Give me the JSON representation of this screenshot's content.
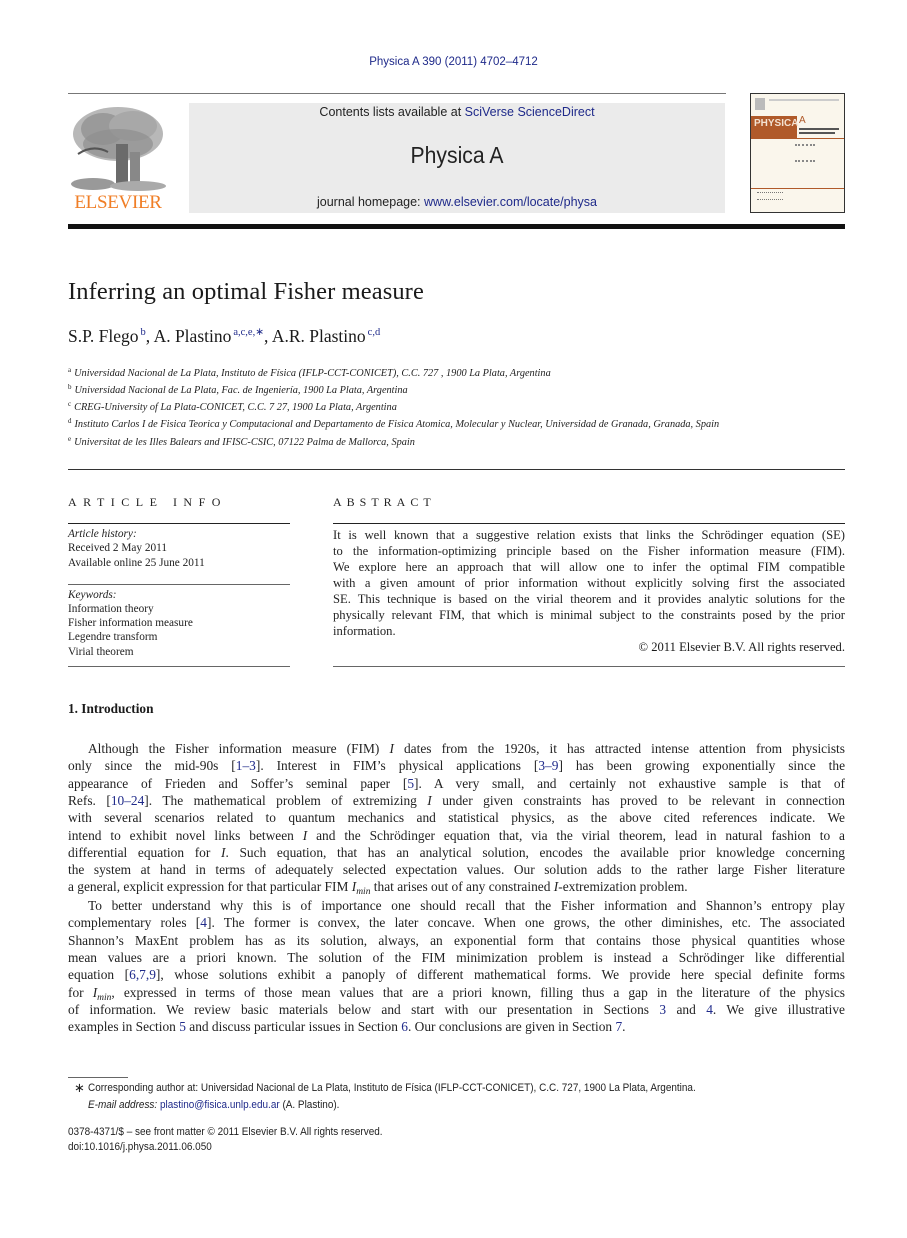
{
  "header": {
    "citation": "Physica A 390 (2011) 4702–4712",
    "contents_prefix": "Contents lists available at ",
    "contents_link": "SciVerse ScienceDirect",
    "journal_name": "Physica A",
    "homepage_prefix": "journal homepage: ",
    "homepage_link": "www.elsevier.com/locate/physa",
    "publisher_logo_text": "ELSEVIER",
    "cover_title": "PHYSICA",
    "cover_letter": "A",
    "colors": {
      "link": "#1f2a8a",
      "elsevier_orange": "#f07e26",
      "banner_bg": "#ebebeb",
      "cover_brown": "#b05a2a"
    }
  },
  "article": {
    "title": "Inferring an optimal Fisher measure",
    "authors": [
      {
        "name": "S.P. Flego",
        "sup": "b",
        "sep": ", "
      },
      {
        "name": "A. Plastino",
        "sup": "a,c,e,∗",
        "sep": ", "
      },
      {
        "name": "A.R. Plastino",
        "sup": "c,d",
        "sep": ""
      }
    ],
    "affiliations": [
      {
        "key": "a",
        "text": "Universidad Nacional de La Plata, Instituto de Física (IFLP-CCT-CONICET), C.C. 727 , 1900 La Plata, Argentina"
      },
      {
        "key": "b",
        "text": "Universidad Nacional de La Plata, Fac. de Ingeniería, 1900 La Plata, Argentina"
      },
      {
        "key": "c",
        "text": "CREG-University of La Plata-CONICET, C.C. 7 27, 1900 La Plata, Argentina"
      },
      {
        "key": "d",
        "text": "Instituto Carlos I de Fisica Teorica y Computacional and Departamento de Fisica Atomica, Molecular y Nuclear, Universidad de Granada, Granada, Spain"
      },
      {
        "key": "e",
        "text": "Universitat de les Illes Balears and IFISC-CSIC, 07122 Palma de Mallorca, Spain"
      }
    ]
  },
  "article_info": {
    "heading": "ARTICLE INFO",
    "history_label": "Article history:",
    "received": "Received 2 May 2011",
    "available": "Available online 25 June 2011",
    "keywords_label": "Keywords:",
    "keywords": [
      "Information theory",
      "Fisher information measure",
      "Legendre transform",
      "Virial theorem"
    ]
  },
  "abstract": {
    "heading": "ABSTRACT",
    "lines": [
      "It is well known that a suggestive relation exists that links the Schrödinger equation (SE)",
      "to the information-optimizing principle based on the Fisher information measure (FIM).",
      "We explore here an approach that will allow one to infer the optimal FIM compatible",
      "with a given amount of prior information without explicitly solving first the associated",
      "SE. This technique is based on the virial theorem and it provides analytic solutions for the",
      "physically relevant FIM, that which is minimal subject to the constraints posed by the prior",
      "information."
    ],
    "copyright": "© 2011 Elsevier B.V. All rights reserved."
  },
  "introduction": {
    "heading": "1.  Introduction",
    "paragraph1": [
      [
        "Although the Fisher information measure (FIM) ",
        {
          "i": "I"
        },
        " dates from the 1920s, it has attracted intense attention from physicists"
      ],
      [
        "only since the mid-90s [",
        {
          "ref": "1–3"
        },
        "]. Interest in FIM’s physical applications [",
        {
          "ref": "3–9"
        },
        "] has been growing exponentially since the"
      ],
      [
        "appearance of Frieden and Soffer’s seminal paper [",
        {
          "ref": "5"
        },
        "]. A very small, and certainly not exhaustive sample is that of"
      ],
      [
        "Refs. [",
        {
          "ref": "10–24"
        },
        "]. The mathematical problem of extremizing ",
        {
          "i": "I"
        },
        " under given constraints has proved to be relevant in connection"
      ],
      [
        "with several scenarios related to quantum mechanics and statistical physics, as the above cited references indicate. We"
      ],
      [
        "intend to exhibit novel links between ",
        {
          "i": "I"
        },
        " and the Schrödinger equation that, via the virial theorem, lead in natural fashion to a"
      ],
      [
        "differential equation for ",
        {
          "i": "I"
        },
        ". Such equation, that has an analytical solution, encodes the available prior knowledge concerning"
      ],
      [
        "the system at hand in terms of adequately selected expectation values. Our solution adds to the rather large Fisher literature"
      ],
      [
        "a general, explicit expression for that particular FIM ",
        {
          "i": "I",
          "sub": "min"
        },
        " that arises out of any constrained ",
        {
          "i": "I"
        },
        "-extremization problem."
      ]
    ],
    "paragraph2": [
      [
        "To better understand why this is of importance one should recall that the Fisher information and Shannon’s entropy play"
      ],
      [
        "complementary roles [",
        {
          "ref": "4"
        },
        "]. The former is convex, the later concave. When one grows, the other diminishes, etc. The associated"
      ],
      [
        "Shannon’s MaxEnt problem has as its solution, always, an exponential form that contains those physical quantities whose"
      ],
      [
        "mean values are a priori known. The solution of the FIM minimization problem is instead a Schrödinger like differential"
      ],
      [
        "equation [",
        {
          "ref": "6,7,9"
        },
        "], whose solutions exhibit a panoply of different mathematical forms. We provide here special definite forms"
      ],
      [
        "for ",
        {
          "i": "I",
          "sub": "min"
        },
        ", expressed in terms of those mean values that are a priori known, filling thus a gap in the literature of the physics"
      ],
      [
        "of information. We review basic materials below and start with our presentation in Sections ",
        {
          "ref": "3"
        },
        " and ",
        {
          "ref": "4"
        },
        ". We give illustrative"
      ],
      [
        "examples in Section ",
        {
          "ref": "5"
        },
        " and discuss particular issues in Section ",
        {
          "ref": "6"
        },
        ". Our conclusions are given in Section ",
        {
          "ref": "7"
        },
        "."
      ]
    ]
  },
  "footnotes": {
    "star": "∗",
    "corresponding": "Corresponding author at: Universidad Nacional de La Plata, Instituto de Física (IFLP-CCT-CONICET), C.C. 727, 1900 La Plata, Argentina.",
    "email_label": "E-mail address: ",
    "email": "plastino@fisica.unlp.edu.ar",
    "email_suffix": " (A. Plastino).",
    "issn": "0378-4371/$ – see front matter © 2011 Elsevier B.V. All rights reserved.",
    "doi": "doi:10.1016/j.physa.2011.06.050"
  }
}
